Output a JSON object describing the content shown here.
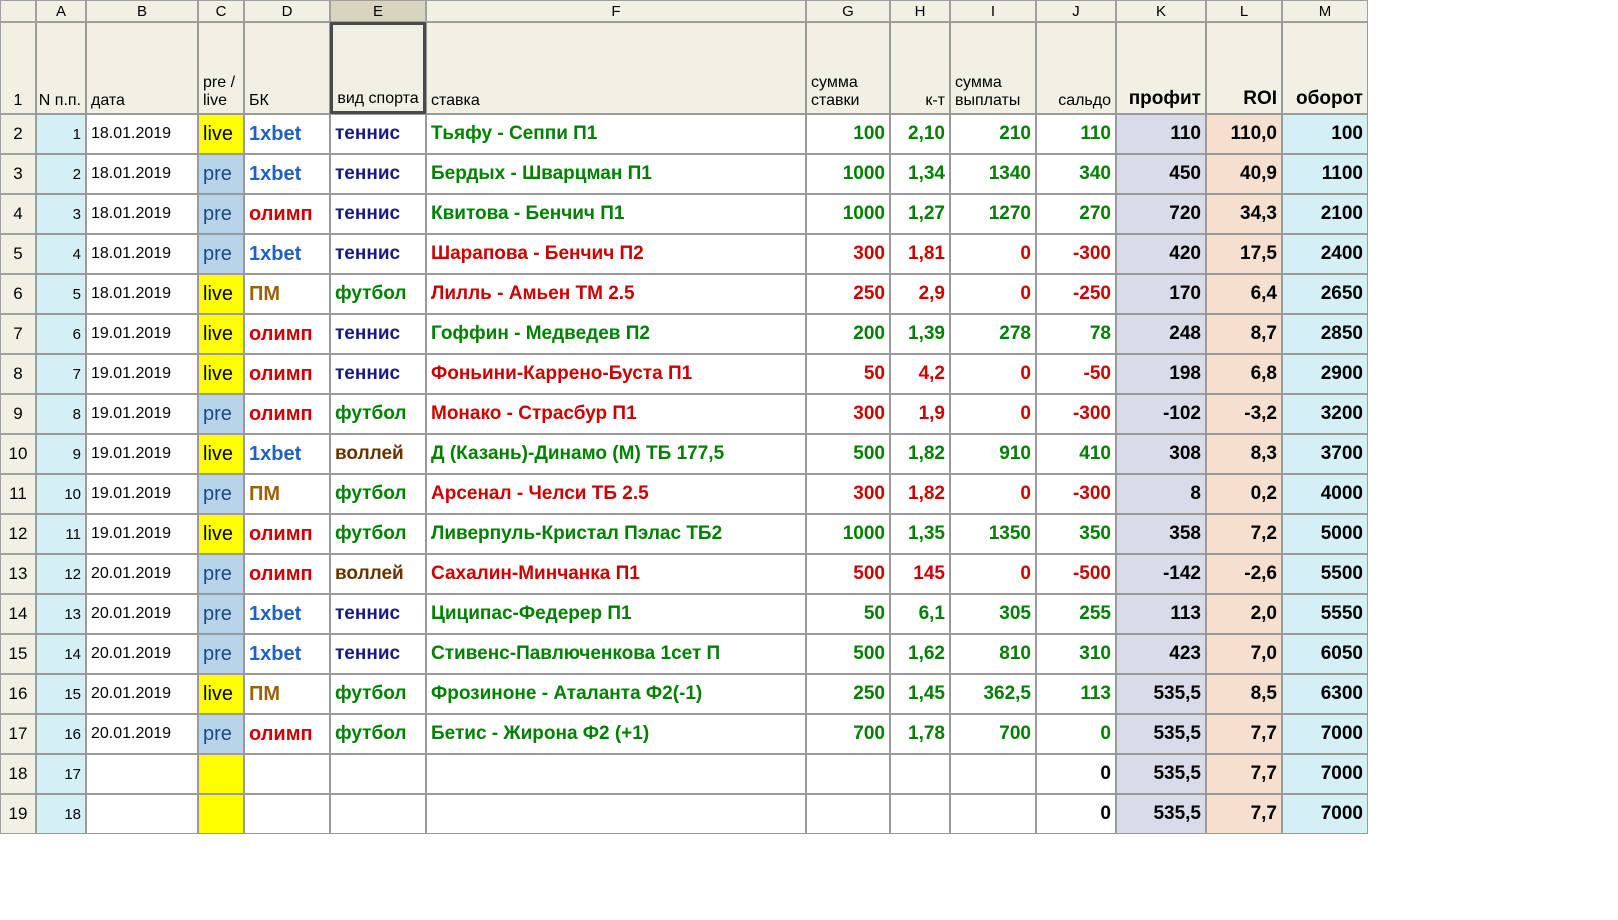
{
  "columns": [
    "",
    "A",
    "B",
    "C",
    "D",
    "E",
    "F",
    "G",
    "H",
    "I",
    "J",
    "K",
    "L",
    "M"
  ],
  "headers": {
    "rownum": "1",
    "A": "N п.п.",
    "B": "дата",
    "C": "pre / live",
    "D": "БК",
    "E": "вид спорта",
    "F": "ставка",
    "G": "сумма ставки",
    "H": "к-т",
    "I": "сумма выплаты",
    "J": "сальдо",
    "K": "профит",
    "L": "ROI",
    "M": "оборот"
  },
  "rows": [
    {
      "rn": "2",
      "n": "1",
      "date": "18.01.2019",
      "mode": "live",
      "bk": "1xbet",
      "sport": "теннис",
      "sportc": "sp-tennis",
      "bet": "Тьяфу - Сеппи П1",
      "outc": "win",
      "sum": "100",
      "kt": "2,10",
      "pay": "210",
      "saldo": "110",
      "profit": "110",
      "roi": "110,0",
      "turn": "100"
    },
    {
      "rn": "3",
      "n": "2",
      "date": "18.01.2019",
      "mode": "pre",
      "bk": "1xbet",
      "sport": "теннис",
      "sportc": "sp-tennis",
      "bet": "Бердых - Шварцман П1",
      "outc": "win",
      "sum": "1000",
      "kt": "1,34",
      "pay": "1340",
      "saldo": "340",
      "profit": "450",
      "roi": "40,9",
      "turn": "1100"
    },
    {
      "rn": "4",
      "n": "3",
      "date": "18.01.2019",
      "mode": "pre",
      "bk": "олимп",
      "sport": "теннис",
      "sportc": "sp-tennis",
      "bet": "Квитова - Бенчич П1",
      "outc": "win",
      "sum": "1000",
      "kt": "1,27",
      "pay": "1270",
      "saldo": "270",
      "profit": "720",
      "roi": "34,3",
      "turn": "2100"
    },
    {
      "rn": "5",
      "n": "4",
      "date": "18.01.2019",
      "mode": "pre",
      "bk": "1xbet",
      "sport": "теннис",
      "sportc": "sp-tennis",
      "bet": "Шарапова - Бенчич П2",
      "outc": "lose",
      "sum": "300",
      "kt": "1,81",
      "pay": "0",
      "saldo": "-300",
      "profit": "420",
      "roi": "17,5",
      "turn": "2400"
    },
    {
      "rn": "6",
      "n": "5",
      "date": "18.01.2019",
      "mode": "live",
      "bk": "ПМ",
      "sport": "футбол",
      "sportc": "sp-football",
      "bet": "Лилль - Амьен ТМ 2.5",
      "outc": "lose",
      "sum": "250",
      "kt": "2,9",
      "pay": "0",
      "saldo": "-250",
      "profit": "170",
      "roi": "6,4",
      "turn": "2650"
    },
    {
      "rn": "7",
      "n": "6",
      "date": "19.01.2019",
      "mode": "live",
      "bk": "олимп",
      "sport": "теннис",
      "sportc": "sp-tennis",
      "bet": "Гоффин - Медведев П2",
      "outc": "win",
      "sum": "200",
      "kt": "1,39",
      "pay": "278",
      "saldo": "78",
      "profit": "248",
      "roi": "8,7",
      "turn": "2850"
    },
    {
      "rn": "8",
      "n": "7",
      "date": "19.01.2019",
      "mode": "live",
      "bk": "олимп",
      "sport": "теннис",
      "sportc": "sp-tennis",
      "bet": "Фоньини-Каррено-Буста П1",
      "outc": "lose",
      "sum": "50",
      "kt": "4,2",
      "pay": "0",
      "saldo": "-50",
      "profit": "198",
      "roi": "6,8",
      "turn": "2900"
    },
    {
      "rn": "9",
      "n": "8",
      "date": "19.01.2019",
      "mode": "pre",
      "bk": "олимп",
      "sport": "футбол",
      "sportc": "sp-football",
      "bet": "Монако - Страсбур П1",
      "outc": "lose",
      "sum": "300",
      "kt": "1,9",
      "pay": "0",
      "saldo": "-300",
      "profit": "-102",
      "roi": "-3,2",
      "turn": "3200"
    },
    {
      "rn": "10",
      "n": "9",
      "date": "19.01.2019",
      "mode": "live",
      "bk": "1xbet",
      "sport": "воллей",
      "sportc": "sp-volley",
      "bet": "Д (Казань)-Динамо (М) ТБ 177,5",
      "outc": "win",
      "sum": "500",
      "kt": "1,82",
      "pay": "910",
      "saldo": "410",
      "profit": "308",
      "roi": "8,3",
      "turn": "3700"
    },
    {
      "rn": "11",
      "n": "10",
      "date": "19.01.2019",
      "mode": "pre",
      "bk": "ПМ",
      "sport": "футбол",
      "sportc": "sp-football",
      "bet": "Арсенал - Челси ТБ 2.5",
      "outc": "lose",
      "sum": "300",
      "kt": "1,82",
      "pay": "0",
      "saldo": "-300",
      "profit": "8",
      "roi": "0,2",
      "turn": "4000"
    },
    {
      "rn": "12",
      "n": "11",
      "date": "19.01.2019",
      "mode": "live",
      "bk": "олимп",
      "sport": "футбол",
      "sportc": "sp-football",
      "bet": "Ливерпуль-Кристал Пэлас ТБ2",
      "outc": "win",
      "sum": "1000",
      "kt": "1,35",
      "pay": "1350",
      "saldo": "350",
      "profit": "358",
      "roi": "7,2",
      "turn": "5000"
    },
    {
      "rn": "13",
      "n": "12",
      "date": "20.01.2019",
      "mode": "pre",
      "bk": "олимп",
      "sport": "воллей",
      "sportc": "sp-volley",
      "bet": "Сахалин-Минчанка П1",
      "outc": "lose",
      "sum": "500",
      "kt": "145",
      "pay": "0",
      "saldo": "-500",
      "profit": "-142",
      "roi": "-2,6",
      "turn": "5500"
    },
    {
      "rn": "14",
      "n": "13",
      "date": "20.01.2019",
      "mode": "pre",
      "bk": "1xbet",
      "sport": "теннис",
      "sportc": "sp-tennis",
      "bet": "Циципас-Федерер П1",
      "outc": "win",
      "sum": "50",
      "kt": "6,1",
      "pay": "305",
      "saldo": "255",
      "profit": "113",
      "roi": "2,0",
      "turn": "5550"
    },
    {
      "rn": "15",
      "n": "14",
      "date": "20.01.2019",
      "mode": "pre",
      "bk": "1xbet",
      "sport": "теннис",
      "sportc": "sp-tennis",
      "bet": "Стивенс-Павлюченкова 1сет П",
      "outc": "win",
      "sum": "500",
      "kt": "1,62",
      "pay": "810",
      "saldo": "310",
      "profit": "423",
      "roi": "7,0",
      "turn": "6050"
    },
    {
      "rn": "16",
      "n": "15",
      "date": "20.01.2019",
      "mode": "live",
      "bk": "ПМ",
      "sport": "футбол",
      "sportc": "sp-football",
      "bet": "Фрозиноне - Аталанта Ф2(-1)",
      "outc": "win",
      "sum": "250",
      "kt": "1,45",
      "pay": "362,5",
      "saldo": "113",
      "profit": "535,5",
      "roi": "8,5",
      "turn": "6300"
    },
    {
      "rn": "17",
      "n": "16",
      "date": "20.01.2019",
      "mode": "pre",
      "bk": "олимп",
      "sport": "футбол",
      "sportc": "sp-football",
      "bet": "Бетис - Жирона Ф2 (+1)",
      "outc": "win",
      "sum": "700",
      "kt": "1,78",
      "pay": "700",
      "saldo": "0",
      "profit": "535,5",
      "roi": "7,7",
      "turn": "7000"
    }
  ],
  "empty_rows": [
    {
      "rn": "18",
      "n": "17",
      "j": "0",
      "profit": "535,5",
      "roi": "7,7",
      "turn": "7000"
    },
    {
      "rn": "19",
      "n": "18",
      "j": "0",
      "profit": "535,5",
      "roi": "7,7",
      "turn": "7000"
    }
  ]
}
